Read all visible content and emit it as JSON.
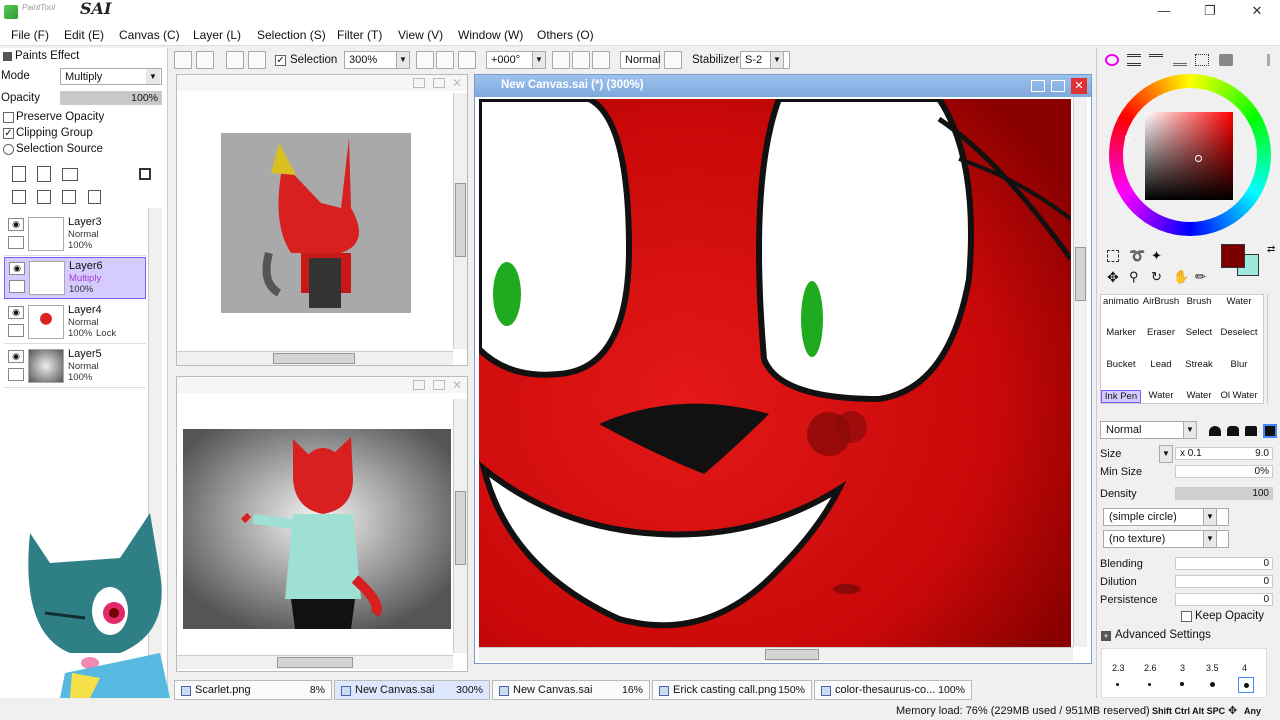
{
  "app": {
    "title": "SAI",
    "subtitle": "PaintTool"
  },
  "menu": [
    "File (F)",
    "Edit (E)",
    "Canvas (C)",
    "Layer (L)",
    "Selection (S)",
    "Filter (T)",
    "View (V)",
    "Window (W)",
    "Others (O)"
  ],
  "toolbar": {
    "selection_label": "Selection",
    "zoom": "300%",
    "rotation": "+000°",
    "blend": "Normal",
    "stabilizer_label": "Stabilizer",
    "stabilizer": "S-2"
  },
  "left": {
    "paints_effect": "Paints Effect",
    "mode_label": "Mode",
    "mode_value": "Multiply",
    "opacity_label": "Opacity",
    "opacity_value": "100%",
    "opacity": 1.0,
    "preserve_opacity": "Preserve Opacity",
    "clipping_group": "Clipping Group",
    "selection_source": "Selection Source",
    "layers": [
      {
        "name": "Layer3",
        "mode": "Normal",
        "opacity": "100%",
        "extra": ""
      },
      {
        "name": "Layer6",
        "mode": "Multiply",
        "opacity": "100%",
        "extra": ""
      },
      {
        "name": "Layer4",
        "mode": "Normal",
        "opacity": "100%",
        "extra": "Lock"
      },
      {
        "name": "Layer5",
        "mode": "Normal",
        "opacity": "100%",
        "extra": ""
      }
    ]
  },
  "canvas": {
    "title": "New Canvas.sai (*) (300%)"
  },
  "colors": {
    "primary": "#7a0000",
    "secondary": "#9fe8dc",
    "accent": "#d21a1a"
  },
  "tools": {
    "row1": [
      "animatio",
      "AirBrush",
      "Brush",
      "Water"
    ],
    "row2": [
      "Marker",
      "Eraser",
      "Select",
      "Deselect"
    ],
    "row3": [
      "Bucket",
      "Lead",
      "Streak",
      "Blur"
    ],
    "row4": [
      "Ink Pen",
      "Water",
      "Water",
      "Ol Water"
    ]
  },
  "brush": {
    "blend_mode": "Normal",
    "size_label": "Size",
    "size_mult": "x 0.1",
    "size_value": "9.0",
    "min_size_label": "Min Size",
    "min_size_value": "0%",
    "density_label": "Density",
    "density_value": "100",
    "shape": "(simple circle)",
    "texture": "(no texture)",
    "blending_label": "Blending",
    "blending_value": "0",
    "dilution_label": "Dilution",
    "dilution_value": "0",
    "persistence_label": "Persistence",
    "persistence_value": "0",
    "keep_opacity": "Keep Opacity",
    "advanced": "Advanced Settings",
    "dot_sizes": [
      "2.3",
      "2.6",
      "3",
      "3.5",
      "4"
    ]
  },
  "tabs": [
    {
      "name": "Scarlet.png",
      "pct": "8%"
    },
    {
      "name": "New Canvas.sai",
      "pct": "300%"
    },
    {
      "name": "New Canvas.sai",
      "pct": "16%"
    },
    {
      "name": "Erick casting call.png",
      "pct": "150%"
    },
    {
      "name": "color-thesaurus-co...",
      "pct": "100%"
    }
  ],
  "status": {
    "memory": "Memory load: 76% (229MB used / 951MB reserved)",
    "keys": "Shift Ctrl Alt SPC",
    "any": "Any"
  }
}
